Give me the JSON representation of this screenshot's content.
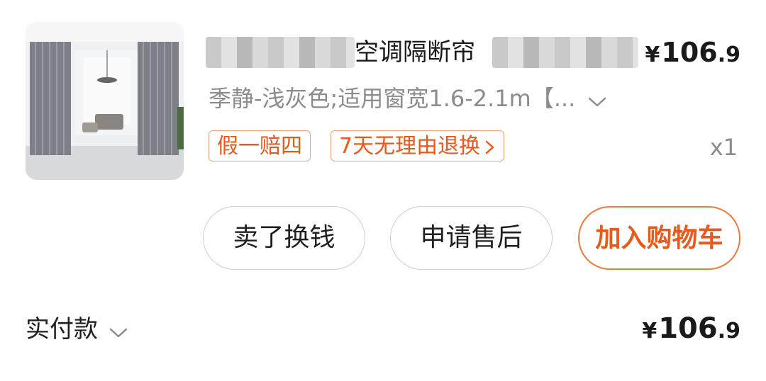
{
  "product": {
    "title": "空调隔断帘",
    "price": {
      "currency": "¥",
      "integer": "106",
      "decimal": ".9"
    },
    "variant": "季静-浅灰色;适用窗宽1.6-2.1m【...",
    "tags": [
      "假一赔四",
      "7天无理由退换"
    ],
    "quantity": "x1",
    "image_icon": "curtain-product-photo-icon"
  },
  "actions": {
    "sell": "卖了换钱",
    "after_sale": "申请售后",
    "add_to_cart": "加入购物车"
  },
  "payment": {
    "label": "实付款",
    "price": {
      "currency": "¥",
      "integer": "106",
      "decimal": ".9"
    }
  },
  "colors": {
    "accent": "#e8591a",
    "accent_border": "#f07a3a",
    "muted_text": "#8c8c8c"
  }
}
